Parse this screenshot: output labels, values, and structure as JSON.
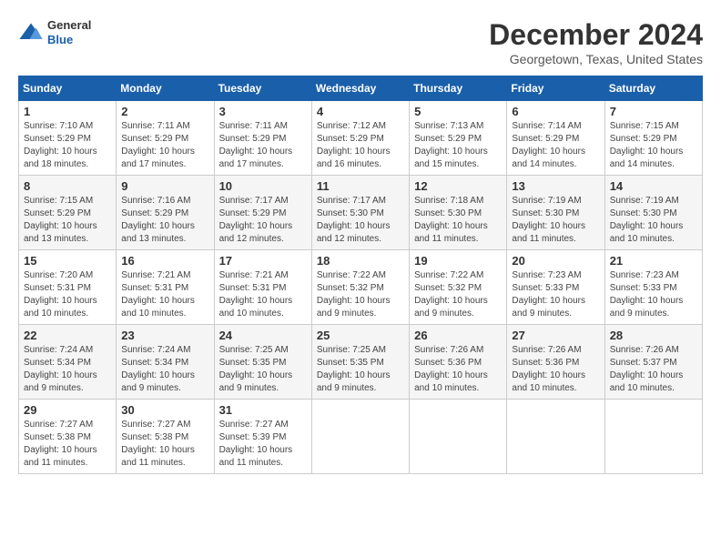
{
  "logo": {
    "general": "General",
    "blue": "Blue"
  },
  "title": "December 2024",
  "location": "Georgetown, Texas, United States",
  "days_of_week": [
    "Sunday",
    "Monday",
    "Tuesday",
    "Wednesday",
    "Thursday",
    "Friday",
    "Saturday"
  ],
  "weeks": [
    [
      {
        "day": "1",
        "sunrise": "7:10 AM",
        "sunset": "5:29 PM",
        "daylight": "10 hours and 18 minutes."
      },
      {
        "day": "2",
        "sunrise": "7:11 AM",
        "sunset": "5:29 PM",
        "daylight": "10 hours and 17 minutes."
      },
      {
        "day": "3",
        "sunrise": "7:11 AM",
        "sunset": "5:29 PM",
        "daylight": "10 hours and 17 minutes."
      },
      {
        "day": "4",
        "sunrise": "7:12 AM",
        "sunset": "5:29 PM",
        "daylight": "10 hours and 16 minutes."
      },
      {
        "day": "5",
        "sunrise": "7:13 AM",
        "sunset": "5:29 PM",
        "daylight": "10 hours and 15 minutes."
      },
      {
        "day": "6",
        "sunrise": "7:14 AM",
        "sunset": "5:29 PM",
        "daylight": "10 hours and 14 minutes."
      },
      {
        "day": "7",
        "sunrise": "7:15 AM",
        "sunset": "5:29 PM",
        "daylight": "10 hours and 14 minutes."
      }
    ],
    [
      {
        "day": "8",
        "sunrise": "7:15 AM",
        "sunset": "5:29 PM",
        "daylight": "10 hours and 13 minutes."
      },
      {
        "day": "9",
        "sunrise": "7:16 AM",
        "sunset": "5:29 PM",
        "daylight": "10 hours and 13 minutes."
      },
      {
        "day": "10",
        "sunrise": "7:17 AM",
        "sunset": "5:29 PM",
        "daylight": "10 hours and 12 minutes."
      },
      {
        "day": "11",
        "sunrise": "7:17 AM",
        "sunset": "5:30 PM",
        "daylight": "10 hours and 12 minutes."
      },
      {
        "day": "12",
        "sunrise": "7:18 AM",
        "sunset": "5:30 PM",
        "daylight": "10 hours and 11 minutes."
      },
      {
        "day": "13",
        "sunrise": "7:19 AM",
        "sunset": "5:30 PM",
        "daylight": "10 hours and 11 minutes."
      },
      {
        "day": "14",
        "sunrise": "7:19 AM",
        "sunset": "5:30 PM",
        "daylight": "10 hours and 10 minutes."
      }
    ],
    [
      {
        "day": "15",
        "sunrise": "7:20 AM",
        "sunset": "5:31 PM",
        "daylight": "10 hours and 10 minutes."
      },
      {
        "day": "16",
        "sunrise": "7:21 AM",
        "sunset": "5:31 PM",
        "daylight": "10 hours and 10 minutes."
      },
      {
        "day": "17",
        "sunrise": "7:21 AM",
        "sunset": "5:31 PM",
        "daylight": "10 hours and 10 minutes."
      },
      {
        "day": "18",
        "sunrise": "7:22 AM",
        "sunset": "5:32 PM",
        "daylight": "10 hours and 9 minutes."
      },
      {
        "day": "19",
        "sunrise": "7:22 AM",
        "sunset": "5:32 PM",
        "daylight": "10 hours and 9 minutes."
      },
      {
        "day": "20",
        "sunrise": "7:23 AM",
        "sunset": "5:33 PM",
        "daylight": "10 hours and 9 minutes."
      },
      {
        "day": "21",
        "sunrise": "7:23 AM",
        "sunset": "5:33 PM",
        "daylight": "10 hours and 9 minutes."
      }
    ],
    [
      {
        "day": "22",
        "sunrise": "7:24 AM",
        "sunset": "5:34 PM",
        "daylight": "10 hours and 9 minutes."
      },
      {
        "day": "23",
        "sunrise": "7:24 AM",
        "sunset": "5:34 PM",
        "daylight": "10 hours and 9 minutes."
      },
      {
        "day": "24",
        "sunrise": "7:25 AM",
        "sunset": "5:35 PM",
        "daylight": "10 hours and 9 minutes."
      },
      {
        "day": "25",
        "sunrise": "7:25 AM",
        "sunset": "5:35 PM",
        "daylight": "10 hours and 9 minutes."
      },
      {
        "day": "26",
        "sunrise": "7:26 AM",
        "sunset": "5:36 PM",
        "daylight": "10 hours and 10 minutes."
      },
      {
        "day": "27",
        "sunrise": "7:26 AM",
        "sunset": "5:36 PM",
        "daylight": "10 hours and 10 minutes."
      },
      {
        "day": "28",
        "sunrise": "7:26 AM",
        "sunset": "5:37 PM",
        "daylight": "10 hours and 10 minutes."
      }
    ],
    [
      {
        "day": "29",
        "sunrise": "7:27 AM",
        "sunset": "5:38 PM",
        "daylight": "10 hours and 11 minutes."
      },
      {
        "day": "30",
        "sunrise": "7:27 AM",
        "sunset": "5:38 PM",
        "daylight": "10 hours and 11 minutes."
      },
      {
        "day": "31",
        "sunrise": "7:27 AM",
        "sunset": "5:39 PM",
        "daylight": "10 hours and 11 minutes."
      },
      null,
      null,
      null,
      null
    ]
  ],
  "labels": {
    "sunrise": "Sunrise:",
    "sunset": "Sunset:",
    "daylight": "Daylight:"
  }
}
